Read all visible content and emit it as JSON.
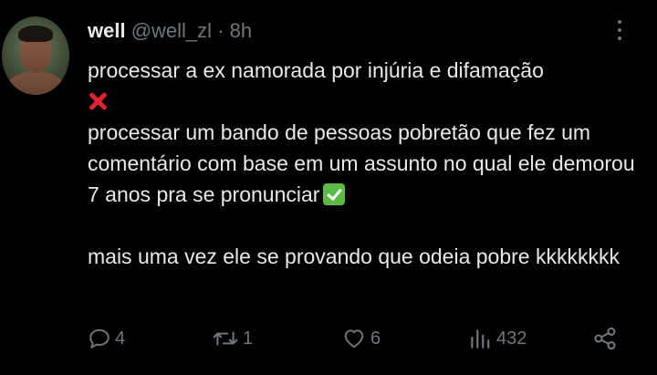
{
  "tweet": {
    "author": {
      "name": "well",
      "handle": "@well_zl",
      "separator": "·",
      "time": "8h"
    },
    "body": {
      "line1": "processar a ex namorada por injúria e difamação",
      "line2": "processar um bando de pessoas pobretão que fez um comentário com base em um assunto no qual ele demorou 7 anos pra se pronunciar",
      "line3": "mais uma vez ele se provando que odeia pobre kkkkkkkk"
    },
    "actions": {
      "replies": "4",
      "retweets": "1",
      "likes": "6",
      "views": "432"
    },
    "icons": {
      "reply": "reply-icon",
      "retweet": "retweet-icon",
      "like": "heart-icon",
      "views": "views-icon",
      "share": "share-icon",
      "more": "more-icon",
      "cross_emoji": "cross-mark-emoji",
      "check_emoji": "check-mark-emoji"
    },
    "colors": {
      "background": "#000000",
      "text": "#e7e9ea",
      "secondary": "#71767b",
      "cross": "#e0212f",
      "check": "#5cba47"
    }
  }
}
